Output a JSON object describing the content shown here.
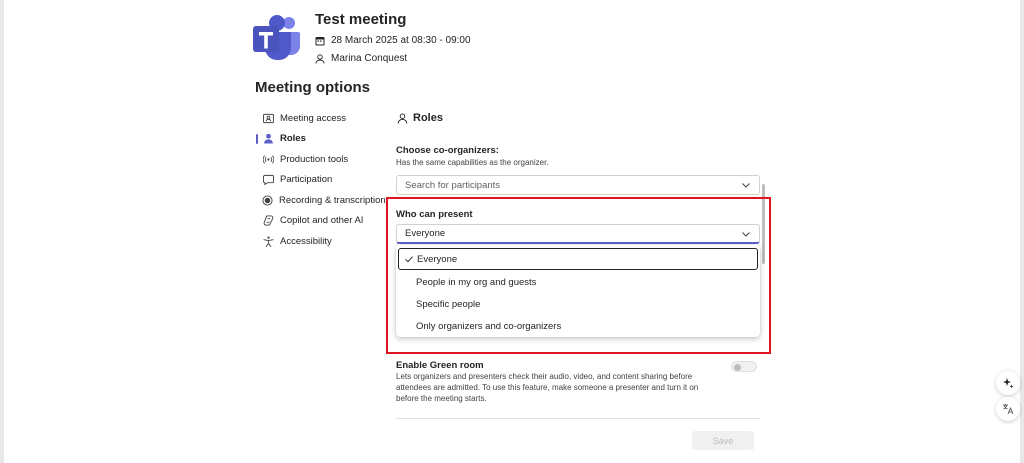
{
  "meeting": {
    "title": "Test meeting",
    "date": "28 March 2025 at 08:30 - 09:00",
    "organizer": "Marina Conquest"
  },
  "page": {
    "title": "Meeting options"
  },
  "sidebar": {
    "items": [
      {
        "label": "Meeting access",
        "icon": "meeting-access-icon"
      },
      {
        "label": "Roles",
        "icon": "person-icon",
        "active": true
      },
      {
        "label": "Production tools",
        "icon": "broadcast-icon"
      },
      {
        "label": "Participation",
        "icon": "chat-icon"
      },
      {
        "label": "Recording & transcription",
        "icon": "record-icon"
      },
      {
        "label": "Copilot and other AI",
        "icon": "copilot-icon"
      },
      {
        "label": "Accessibility",
        "icon": "accessibility-icon"
      }
    ]
  },
  "roles": {
    "heading": "Roles",
    "co_organizers_label": "Choose co-organizers:",
    "co_organizers_sub": "Has the same capabilities as the organizer.",
    "search_placeholder": "Search for participants",
    "who_can_present_label": "Who can present",
    "who_can_present_value": "Everyone",
    "options": [
      "Everyone",
      "People in my org and guests",
      "Specific people",
      "Only organizers and co-organizers"
    ]
  },
  "green_room": {
    "title": "Enable Green room",
    "description": "Lets organizers and presenters check their audio, video, and content sharing before attendees are admitted. To use this feature, make someone a presenter and turn it on before the meeting starts.",
    "enabled": false
  },
  "actions": {
    "save_label": "Save"
  },
  "colors": {
    "accent": "#5b5fc7",
    "highlight": "#e0141e"
  }
}
